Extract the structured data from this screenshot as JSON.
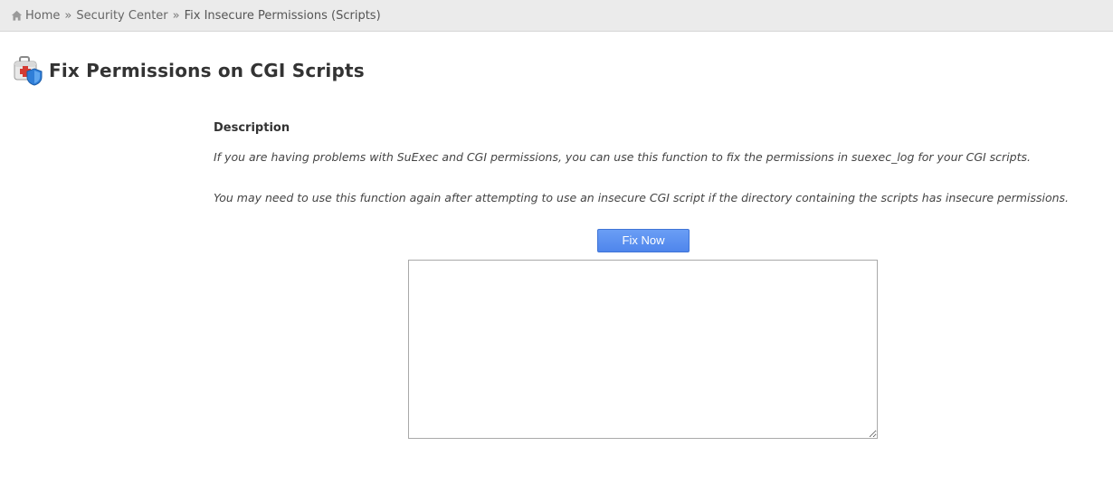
{
  "breadcrumb": {
    "home_icon": "home-icon",
    "home": "Home",
    "separator": "»",
    "security_center": "Security Center",
    "current": "Fix Insecure Permissions (Scripts)"
  },
  "header": {
    "icon": "first-aid-kit-shield-icon",
    "title": "Fix Permissions on CGI Scripts"
  },
  "main": {
    "section_heading": "Description",
    "paragraphs": [
      "If you are having problems with SuExec and CGI permissions, you can use this function to fix the permissions in suexec_log for your CGI scripts.",
      "You may need to use this function again after attempting to use an insecure CGI script if the directory containing the scripts has insecure permissions."
    ],
    "fix_button_label": "Fix Now",
    "output_value": ""
  },
  "colors": {
    "breadcrumb_bg": "#ebebeb",
    "button_bg": "#5b8ff0",
    "button_text": "#ffffff",
    "text": "#333333"
  }
}
